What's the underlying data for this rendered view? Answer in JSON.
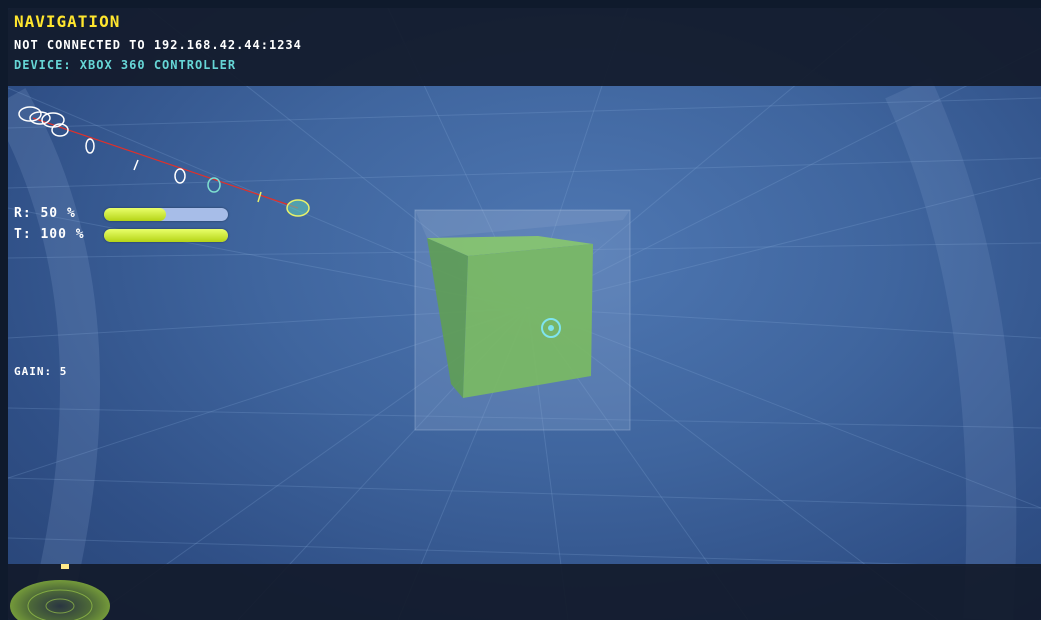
{
  "hud": {
    "title": "NAVIGATION",
    "connection_status": "NOT CONNECTED TO 192.168.42.44:1234",
    "device": "DEVICE: XBOX 360 CONTROLLER",
    "gain": "GAIN: 5"
  },
  "bars": [
    {
      "label": "R: 50 %",
      "value_percent": 50
    },
    {
      "label": "T: 100 %",
      "value_percent": 100
    }
  ],
  "colors": {
    "title": "#ffe62e",
    "device": "#66d6d6",
    "bar_fill": "#c9e430",
    "bar_track": "#a7bde8",
    "cube": "#7cc265",
    "trajectory_line": "#e0302a"
  },
  "icons": {
    "target": "crosshair-target-icon",
    "radar": "radar-icon"
  }
}
